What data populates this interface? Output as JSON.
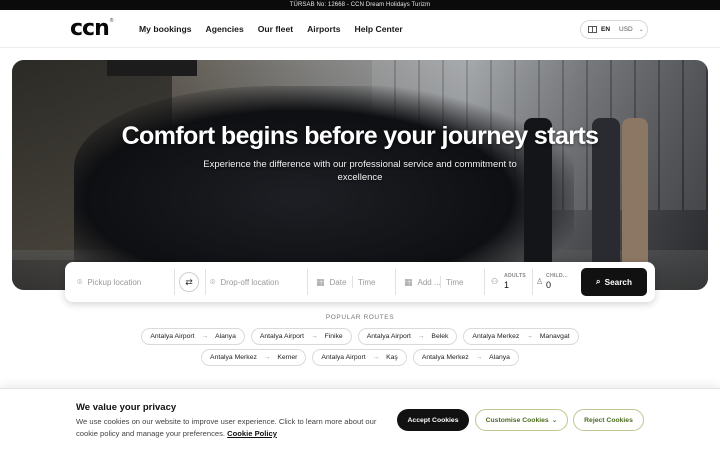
{
  "topbar": {
    "text": "TÜRSAB No: 12668 - CCN Dream Holidays Turizm"
  },
  "header": {
    "logo": "ccn",
    "logo_mark": "®",
    "nav": [
      "My bookings",
      "Agencies",
      "Our fleet",
      "Airports",
      "Help Center"
    ],
    "language": "EN",
    "currency": "USD"
  },
  "hero": {
    "title": "Comfort begins before your journey starts",
    "subtitle": "Experience the difference with our professional service and commitment to excellence"
  },
  "booking": {
    "pickup_placeholder": "Pickup location",
    "dropoff_placeholder": "Drop-off location",
    "date_placeholder": "Date",
    "time_placeholder": "Time",
    "return_date_placeholder": "Add ...",
    "return_time_placeholder": "Time",
    "adults_label": "ADULTS",
    "adults_value": "1",
    "children_label": "CHILD...",
    "children_value": "0",
    "search_label": "Search"
  },
  "popular": {
    "title": "POPULAR ROUTES",
    "routes": [
      {
        "from": "Antalya Airport",
        "to": "Alanya"
      },
      {
        "from": "Antalya Airport",
        "to": "Finike"
      },
      {
        "from": "Antalya Airport",
        "to": "Belek"
      },
      {
        "from": "Antalya Merkez",
        "to": "Manavgat"
      },
      {
        "from": "Antalya Merkez",
        "to": "Kemer"
      },
      {
        "from": "Antalya Airport",
        "to": "Kaş"
      },
      {
        "from": "Antalya Merkez",
        "to": "Alanya"
      }
    ]
  },
  "cookie": {
    "title": "We value your privacy",
    "text": "We use cookies on our website to improve user experience. Click to learn more about our cookie policy and manage your preferences.",
    "policy_link": "Cookie Policy",
    "accept_label": "Accept Cookies",
    "customise_label": "Customise Cookies",
    "reject_label": "Reject Cookies"
  },
  "colors": {
    "accent_dark": "#111111",
    "cookie_outline": "#b9c98f",
    "cookie_text_green": "#4d6b1e"
  }
}
